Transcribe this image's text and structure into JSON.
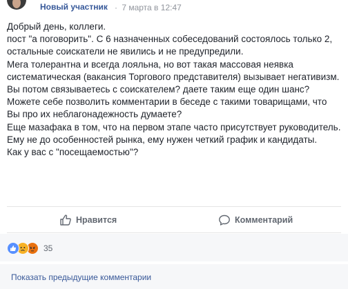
{
  "post": {
    "author": "Новый участник",
    "separator": "·",
    "timestamp": "7 марта в 12:47",
    "paragraphs": [
      "Добрый день, коллеги.",
      "пост \"а поговорить\". С 6 назначенных собеседований состоялось только 2, остальные соискатели не явились и не предупредили.",
      "Мега толерантна и всегда лояльна, но вот такая массовая неявка систематическая (вакансия Торгового представителя) вызывает негативизм.",
      "Вы потом связываетесь с соискателем? даете таким еще один шанс?",
      "Можете себе позволить комментарии в беседе с такими товарищами, что Вы про их неблагонадежность думаете?",
      "Еще мазафака в том, что на первом этапе часто присутствует руководитель. Ему не до особенностей рынка, ему нужен четкий график и кандидаты.",
      "Как у вас с \"посещаемостью\"?"
    ]
  },
  "actions": {
    "like_label": "Нравится",
    "comment_label": "Комментарий"
  },
  "reactions": {
    "icons": [
      "like-icon",
      "sad-icon",
      "angry-icon"
    ],
    "count": "35",
    "colors": {
      "like": "#5890ff",
      "sad": "#f7b125",
      "angry": "#e9710f"
    }
  },
  "comments": {
    "show_previous_label": "Показать предыдущие комментарии"
  },
  "colors": {
    "link": "#365899",
    "muted": "#90949c",
    "text": "#1d2129",
    "action": "#616770"
  }
}
